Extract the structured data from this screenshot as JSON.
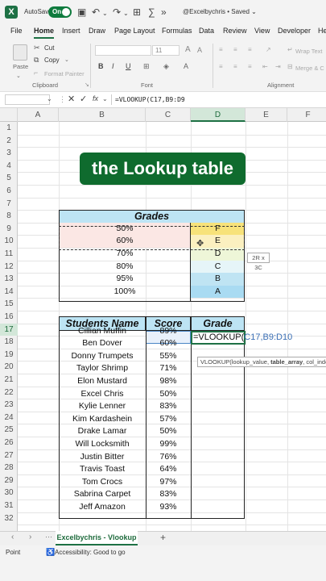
{
  "titlebar": {
    "autosave_label": "AutoSave",
    "autosave_state": "On",
    "doc_title": "@Excelbychris • Saved ⌄"
  },
  "menu": [
    "File",
    "Home",
    "Insert",
    "Draw",
    "Page Layout",
    "Formulas",
    "Data",
    "Review",
    "View",
    "Developer",
    "He"
  ],
  "ribbon": {
    "paste": "Paste",
    "cut": "Cut",
    "copy": "Copy",
    "format_painter": "Format Painter",
    "clipboard": "Clipboard",
    "font_size": "11",
    "font": "Font",
    "bold": "B",
    "italic": "I",
    "underline": "U",
    "wrap_text": "Wrap Text",
    "merge": "Merge & C",
    "alignment": "Alignment"
  },
  "formula_bar": {
    "fx": "fx",
    "formula": "=VLOOKUP(C17,B9:D9"
  },
  "columns": [
    "A",
    "B",
    "C",
    "D",
    "E",
    "F"
  ],
  "rows": [
    "1",
    "2",
    "3",
    "4",
    "5",
    "6",
    "7",
    "8",
    "9",
    "10",
    "11",
    "12",
    "13",
    "14",
    "15",
    "16",
    "17",
    "18",
    "19",
    "20",
    "21",
    "22",
    "23",
    "24",
    "25",
    "26",
    "27",
    "28",
    "29",
    "30",
    "31",
    "32"
  ],
  "banner": "the Lookup table",
  "grades_table": {
    "header": "Grades",
    "rows": [
      {
        "score": "50%",
        "grade": "F"
      },
      {
        "score": "60%",
        "grade": "E"
      },
      {
        "score": "70%",
        "grade": "D"
      },
      {
        "score": "80%",
        "grade": "C"
      },
      {
        "score": "95%",
        "grade": "B"
      },
      {
        "score": "100%",
        "grade": "A"
      }
    ],
    "grade_colors": [
      "#f7e27a",
      "#fbf0c0",
      "#eef6d8",
      "#e6f5f8",
      "#bfe4f3",
      "#a9dbf2"
    ]
  },
  "students_table": {
    "headers": [
      "Students Name",
      "Score",
      "Grade"
    ],
    "rows": [
      {
        "name": "Cillian Muffin",
        "score": "89%"
      },
      {
        "name": "Ben Dover",
        "score": "60%"
      },
      {
        "name": "Donny Trumpets",
        "score": "55%"
      },
      {
        "name": "Taylor Shrimp",
        "score": "71%"
      },
      {
        "name": "Elon Mustard",
        "score": "98%"
      },
      {
        "name": "Excel Chris",
        "score": "50%"
      },
      {
        "name": "Kylie Lenner",
        "score": "83%"
      },
      {
        "name": "Kim Kardashein",
        "score": "57%"
      },
      {
        "name": "Drake Lamar",
        "score": "50%"
      },
      {
        "name": "Will Locksmith",
        "score": "99%"
      },
      {
        "name": "Justin Bitter",
        "score": "76%"
      },
      {
        "name": "Travis Toast",
        "score": "64%"
      },
      {
        "name": "Tom Crocs",
        "score": "97%"
      },
      {
        "name": "Sabrina Carpet",
        "score": "83%"
      },
      {
        "name": "Jeff Amazon",
        "score": "93%"
      }
    ]
  },
  "editing": {
    "prefix": "=VLOOKUP(",
    "ref": "C17,B9:D10"
  },
  "size_tip": "2R x 3C",
  "fn_tip": {
    "start": "VLOOKUP(lookup_value, ",
    "bold": "table_array",
    "end": ", col_index"
  },
  "sheet_tab": "Excelbychris - Vlookup",
  "add_sheet": "+",
  "status": {
    "mode": "Point",
    "accessibility": "Accessibility: Good to go"
  },
  "colors": {
    "excel_green": "#1e7145",
    "header_blue": "#bde4f4",
    "banner_green": "#0f6b2e"
  }
}
